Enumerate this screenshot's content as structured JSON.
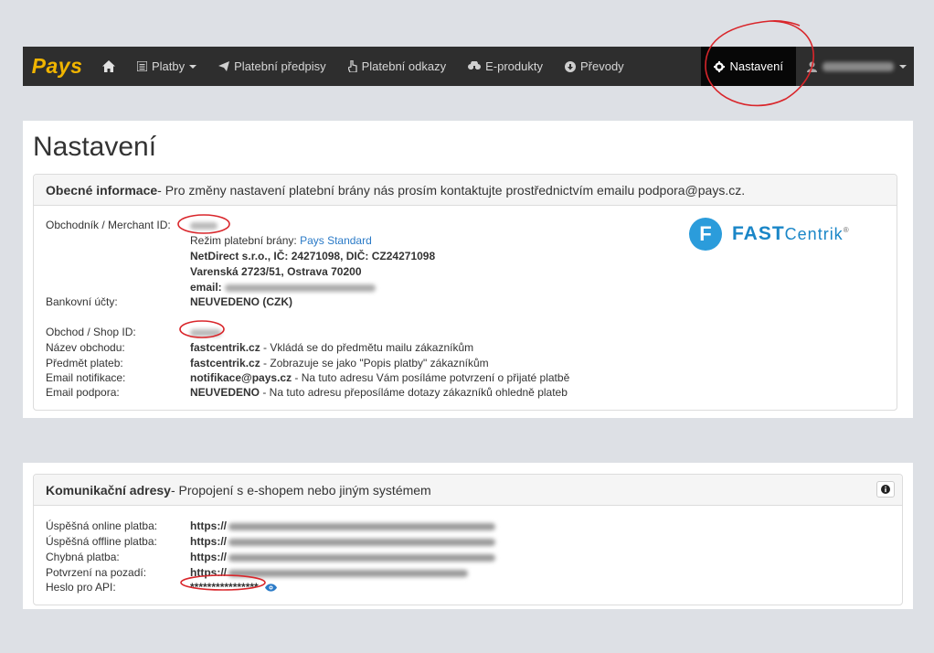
{
  "navbar": {
    "brand": "Pays",
    "items": [
      {
        "label": "Platby",
        "icon": "list-icon",
        "dropdown": true
      },
      {
        "label": "Platební předpisy",
        "icon": "send-icon"
      },
      {
        "label": "Platební odkazy",
        "icon": "hand-pointer-icon"
      },
      {
        "label": "E-produkty",
        "icon": "cloud-download-icon"
      },
      {
        "label": "Převody",
        "icon": "circle-arrow-icon"
      }
    ],
    "active_item": "Nastavení",
    "user_icon": "user-icon"
  },
  "page_title": "Nastavení",
  "general": {
    "heading_bold": "Obecné informace",
    "heading_rest": " - Pro změny nastavení platební brány nás prosím kontaktujte prostřednictvím emailu podpora@pays.cz.",
    "merchant_label": "Obchodník / Merchant ID:",
    "gateway_mode_prefix": "Režim platební brány: ",
    "gateway_mode": "Pays Standard",
    "company": "NetDirect s.r.o., IČ: 24271098, DIČ: CZ24271098",
    "address": "Varenská 2723/51, Ostrava 70200",
    "email_label": "email:",
    "bank_label": "Bankovní účty:",
    "bank_value": "NEUVEDENO (CZK)",
    "shop_id_label": "Obchod / Shop ID:",
    "shop_name_label": "Název obchodu:",
    "shop_name_value": "fastcentrik.cz",
    "shop_name_note": " - Vkládá se do předmětu mailu zákazníkům",
    "subject_label": "Předmět plateb:",
    "subject_value": "fastcentrik.cz",
    "subject_note": " - Zobrazuje se jako \"Popis platby\" zákazníkům",
    "notify_label": "Email notifikace:",
    "notify_value": "notifikace@pays.cz",
    "notify_note": " - Na tuto adresu Vám posíláme potvrzení o přijaté platbě",
    "support_label": "Email podpora:",
    "support_value": "NEUVEDENO",
    "support_note": " - Na tuto adresu přeposíláme dotazy zákazníků ohledně plateb",
    "logo_letter": "F",
    "logo_fast": "FAST",
    "logo_centrik": "Centrik",
    "logo_reg": "®"
  },
  "comm": {
    "heading_bold": "Komunikační adresy",
    "heading_rest": " - Propojení s e-shopem nebo jiným systémem",
    "rows": [
      {
        "label": "Úspěšná online platba:",
        "value": "https://"
      },
      {
        "label": "Úspěšná offline platba:",
        "value": "https://"
      },
      {
        "label": "Chybná platba:",
        "value": "https://"
      },
      {
        "label": "Potvrzení na pozadí:",
        "value": "https://"
      }
    ],
    "api_label": "Heslo pro API:",
    "api_value": "****************"
  },
  "colors": {
    "annotation": "#d9262b",
    "navbar": "#2e2e2e",
    "brand": "#f0b400",
    "link": "#2a7ac7"
  }
}
